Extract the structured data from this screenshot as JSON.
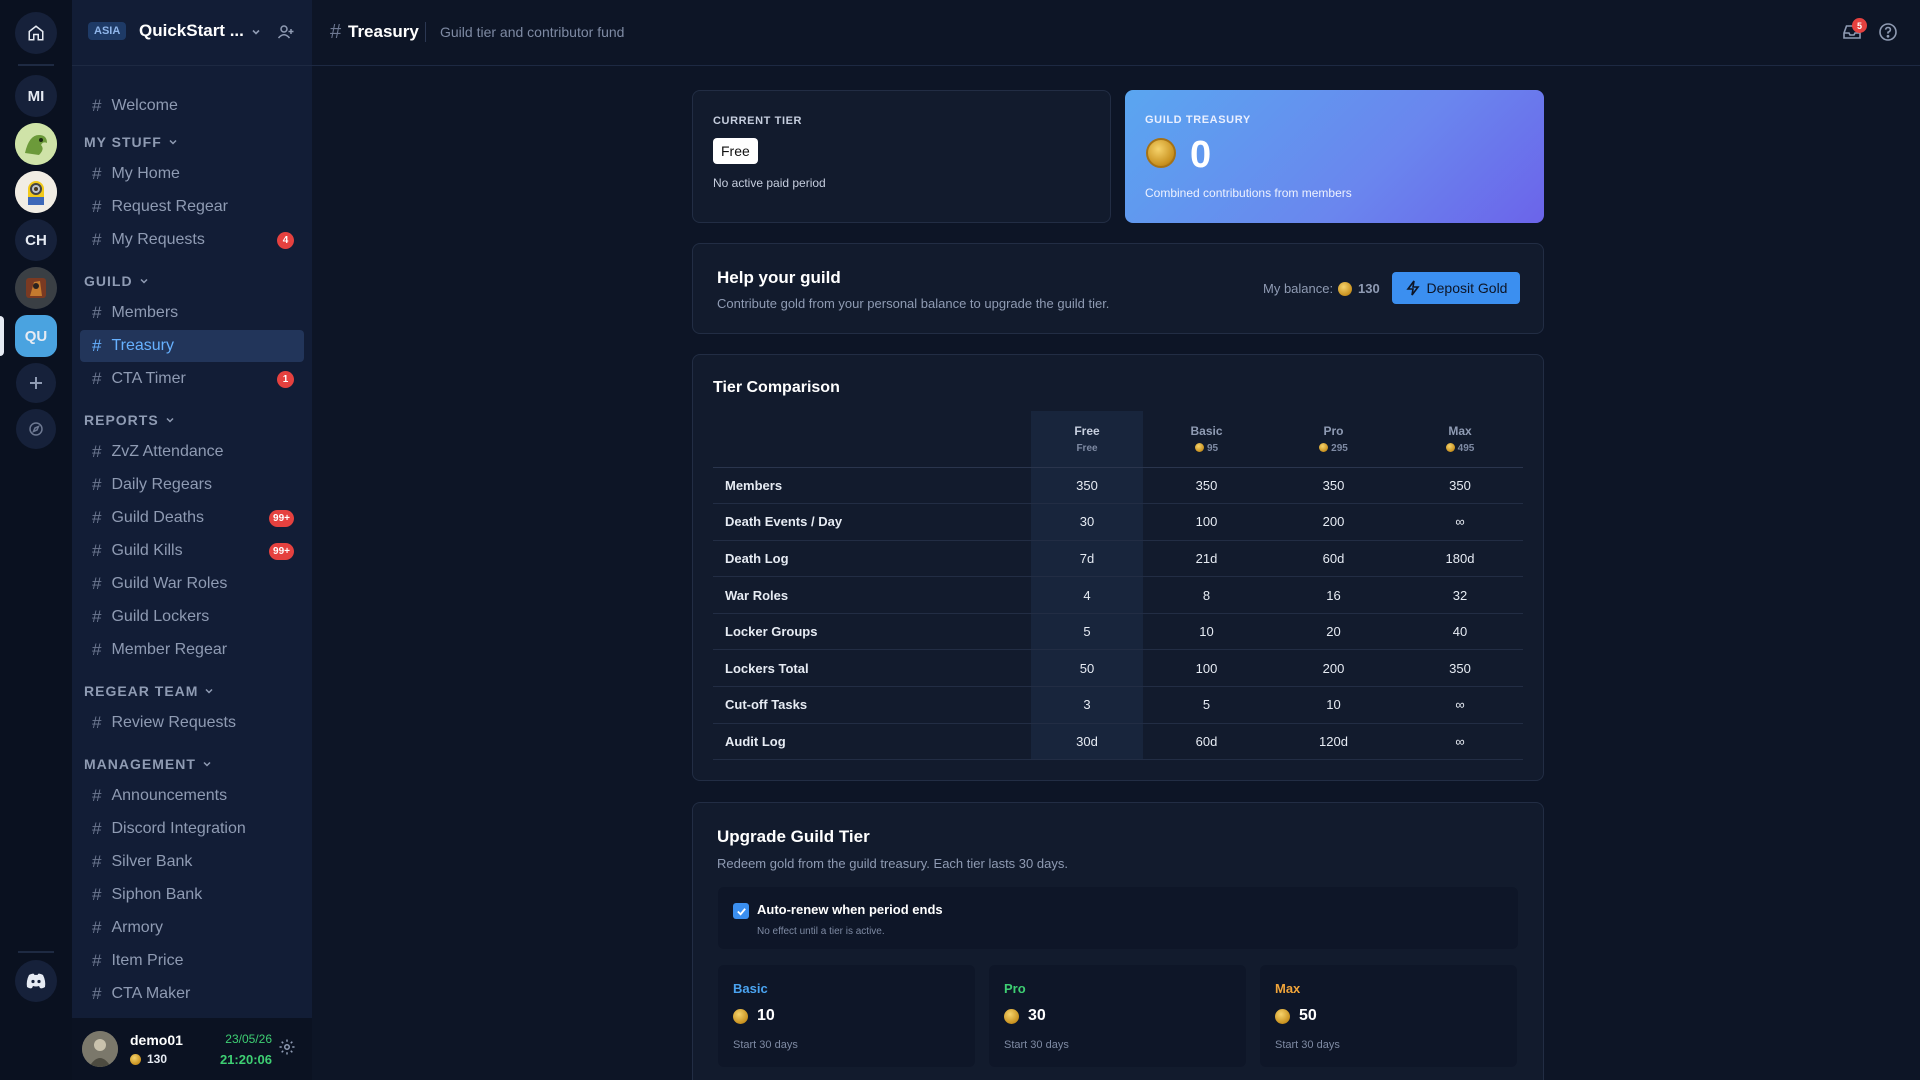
{
  "rail": {
    "servers": [
      "MI",
      "CH",
      "QU"
    ]
  },
  "sidebar": {
    "region": "ASIA",
    "guild_name": "QuickStart ...",
    "welcome": "Welcome",
    "categories": {
      "my_stuff": "MY STUFF",
      "guild": "GUILD",
      "reports": "REPORTS",
      "regear_team": "REGEAR TEAM",
      "management": "MANAGEMENT"
    },
    "channels": {
      "my_home": "My Home",
      "request_regear": "Request Regear",
      "my_requests": "My Requests",
      "members": "Members",
      "treasury": "Treasury",
      "cta_timer": "CTA Timer",
      "zvz_attendance": "ZvZ Attendance",
      "daily_regears": "Daily Regears",
      "guild_deaths": "Guild Deaths",
      "guild_kills": "Guild Kills",
      "guild_war_roles": "Guild War Roles",
      "guild_lockers": "Guild Lockers",
      "member_regear": "Member Regear",
      "review_requests": "Review Requests",
      "announcements": "Announcements",
      "discord_integration": "Discord Integration",
      "silver_bank": "Silver Bank",
      "siphon_bank": "Siphon Bank",
      "armory": "Armory",
      "item_price": "Item Price",
      "cta_maker": "CTA Maker"
    },
    "badges": {
      "my_requests": "4",
      "cta_timer": "1",
      "guild_deaths": "99+",
      "guild_kills": "99+"
    }
  },
  "user": {
    "name": "demo01",
    "gold": "130",
    "date": "23/05/26",
    "time": "21:20:06"
  },
  "header": {
    "title": "Treasury",
    "subtitle": "Guild tier and contributor fund",
    "inbox_count": "5"
  },
  "current_tier": {
    "caption": "CURRENT TIER",
    "tier": "Free",
    "note": "No active paid period"
  },
  "treasury": {
    "caption": "GUILD TREASURY",
    "amount": "0",
    "note": "Combined contributions from members"
  },
  "help": {
    "title": "Help your guild",
    "desc": "Contribute gold from your personal balance to upgrade the guild tier.",
    "balance_label": "My balance:",
    "balance": "130",
    "deposit_label": "Deposit Gold"
  },
  "comparison": {
    "title": "Tier Comparison",
    "tiers": [
      {
        "name": "Free",
        "price": "Free"
      },
      {
        "name": "Basic",
        "price": "95"
      },
      {
        "name": "Pro",
        "price": "295"
      },
      {
        "name": "Max",
        "price": "495"
      }
    ],
    "rows": [
      {
        "label": "Members",
        "values": [
          "350",
          "350",
          "350",
          "350"
        ]
      },
      {
        "label": "Death Events / Day",
        "values": [
          "30",
          "100",
          "200",
          "∞"
        ]
      },
      {
        "label": "Death Log",
        "values": [
          "7d",
          "21d",
          "60d",
          "180d"
        ]
      },
      {
        "label": "War Roles",
        "values": [
          "4",
          "8",
          "16",
          "32"
        ]
      },
      {
        "label": "Locker Groups",
        "values": [
          "5",
          "10",
          "20",
          "40"
        ]
      },
      {
        "label": "Lockers Total",
        "values": [
          "50",
          "100",
          "200",
          "350"
        ]
      },
      {
        "label": "Cut-off Tasks",
        "values": [
          "3",
          "5",
          "10",
          "∞"
        ]
      },
      {
        "label": "Audit Log",
        "values": [
          "30d",
          "60d",
          "120d",
          "∞"
        ]
      }
    ]
  },
  "upgrade": {
    "title": "Upgrade Guild Tier",
    "desc": "Redeem gold from the guild treasury. Each tier lasts 30 days.",
    "autorenew_label": "Auto-renew when period ends",
    "autorenew_note": "No effect until a tier is active.",
    "autorenew_checked": true,
    "plans": [
      {
        "name": "Basic",
        "cost": "10",
        "duration": "Start 30 days",
        "color": "#4aa3f0"
      },
      {
        "name": "Pro",
        "cost": "30",
        "duration": "Start 30 days",
        "color": "#3ecf73"
      },
      {
        "name": "Max",
        "cost": "50",
        "duration": "Start 30 days",
        "color": "#f0a43a"
      }
    ]
  },
  "colors": {
    "accent": "#3b8ff0",
    "badge": "#e5413f",
    "time": "#3ecf73"
  }
}
